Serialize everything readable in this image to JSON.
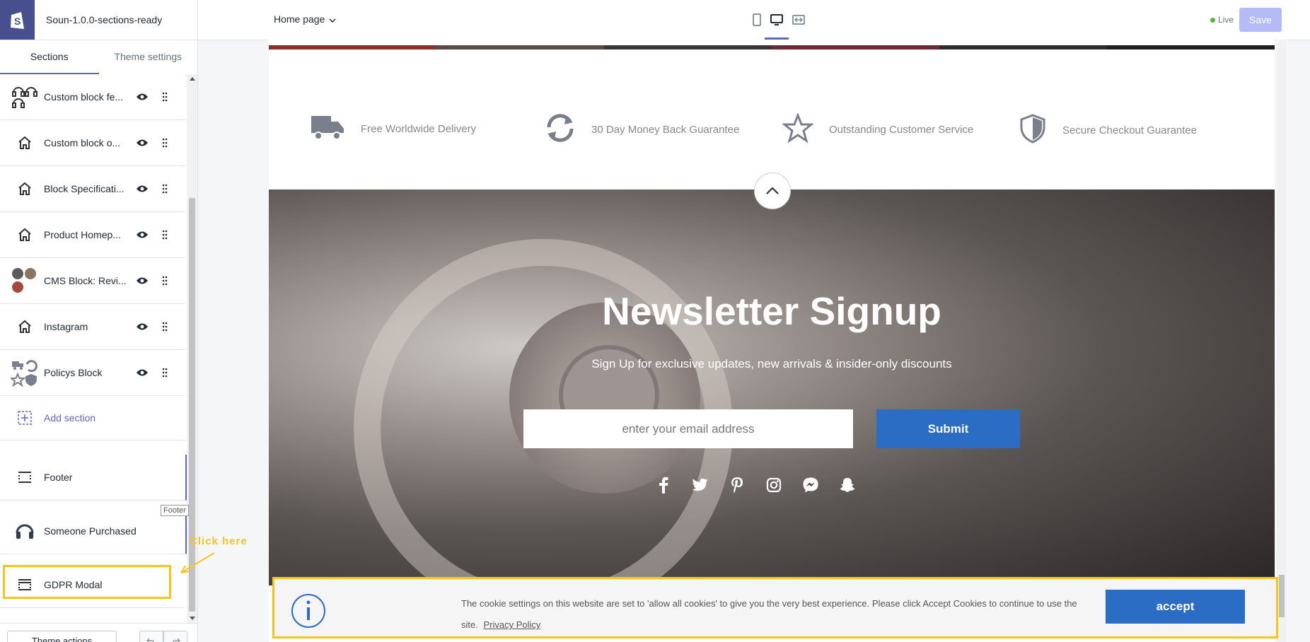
{
  "app": {
    "store_name": "Soun-1.0.0-sections-ready",
    "page_selector": "Home page",
    "live_label": "Live",
    "save_label": "Save",
    "accent": "#5c6ac4"
  },
  "sidebar": {
    "tabs": [
      {
        "label": "Sections"
      },
      {
        "label": "Theme settings"
      }
    ],
    "sections": [
      {
        "label": "Custom block fe...",
        "icon": "headphones-icon"
      },
      {
        "label": "Custom block o...",
        "icon": "home-icon"
      },
      {
        "label": "Block Specificati...",
        "icon": "home-icon"
      },
      {
        "label": "Product Homep...",
        "icon": "home-icon"
      },
      {
        "label": "CMS Block: Revi...",
        "icon": "avatars-icon"
      },
      {
        "label": "Instagram",
        "icon": "home-icon"
      },
      {
        "label": "Policys Block",
        "icon": "policies-icon"
      }
    ],
    "add_section_label": "Add section",
    "fixed_sections": [
      {
        "label": "Footer",
        "icon": "footer-layout-icon"
      },
      {
        "label": "Someone Purchased",
        "icon": "headphones-icon"
      },
      {
        "label": "GDPR Modal",
        "icon": "modal-layout-icon"
      }
    ],
    "tooltip": "Footer",
    "annotation": "Click here",
    "theme_actions_label": "Theme actions"
  },
  "preview": {
    "policies": [
      {
        "label": "Free Worldwide Delivery",
        "icon": "truck-icon"
      },
      {
        "label": "30 Day Money Back Guarantee",
        "icon": "refresh-icon"
      },
      {
        "label": "Outstanding Customer Service",
        "icon": "star-icon"
      },
      {
        "label": "Secure Checkout Guarantee",
        "icon": "shield-icon"
      }
    ],
    "newsletter": {
      "title": "Newsletter Signup",
      "subtitle": "Sign Up for exclusive updates, new arrivals & insider-only discounts",
      "email_placeholder": "enter your email address",
      "submit_label": "Submit"
    },
    "socials": [
      "facebook-icon",
      "twitter-icon",
      "pinterest-icon",
      "instagram-icon",
      "messenger-icon",
      "snapchat-icon"
    ],
    "cookie": {
      "text": "The cookie settings on this website are set to 'allow all cookies' to give you the very best experience. Please click Accept Cookies to continue to use the site.",
      "privacy_label": "Privacy Policy",
      "accept_label": "accept"
    }
  }
}
